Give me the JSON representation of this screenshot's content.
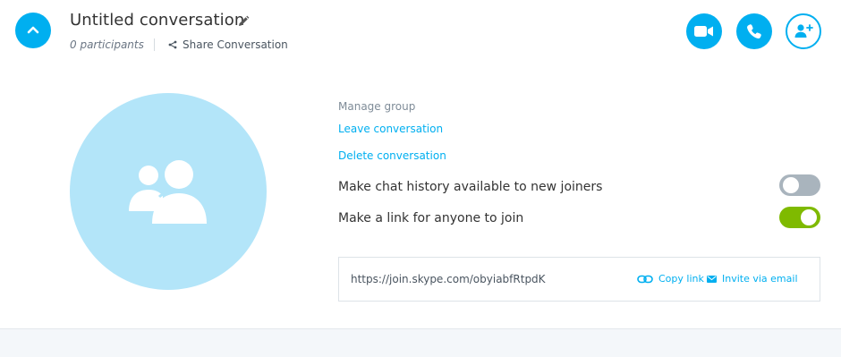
{
  "header": {
    "title": "Untitled conversation",
    "participants": "0 participants",
    "share_label": "Share Conversation"
  },
  "icons": {
    "collapse": "chevron-up-icon",
    "edit": "pencil-icon",
    "share": "share-icon",
    "video": "video-camera-icon",
    "call": "phone-icon",
    "add_person": "add-person-icon",
    "avatar": "group-icon",
    "copy": "link-icon",
    "invite": "envelope-icon"
  },
  "manage": {
    "heading": "Manage group",
    "leave_label": "Leave conversation",
    "delete_label": "Delete conversation"
  },
  "settings": {
    "chat_history_label": "Make chat history available to new joiners",
    "chat_history_enabled": false,
    "join_link_label": "Make a link for anyone to join",
    "join_link_enabled": true
  },
  "join_link": {
    "url": "https://join.skype.com/obyiabfRtpdK",
    "copy_label": "Copy link",
    "invite_label": "Invite via email"
  },
  "colors": {
    "accent": "#00aff0",
    "avatar_bg": "#b3e5f9",
    "toggle_on": "#7fba00",
    "toggle_off": "#a9b4bd"
  }
}
